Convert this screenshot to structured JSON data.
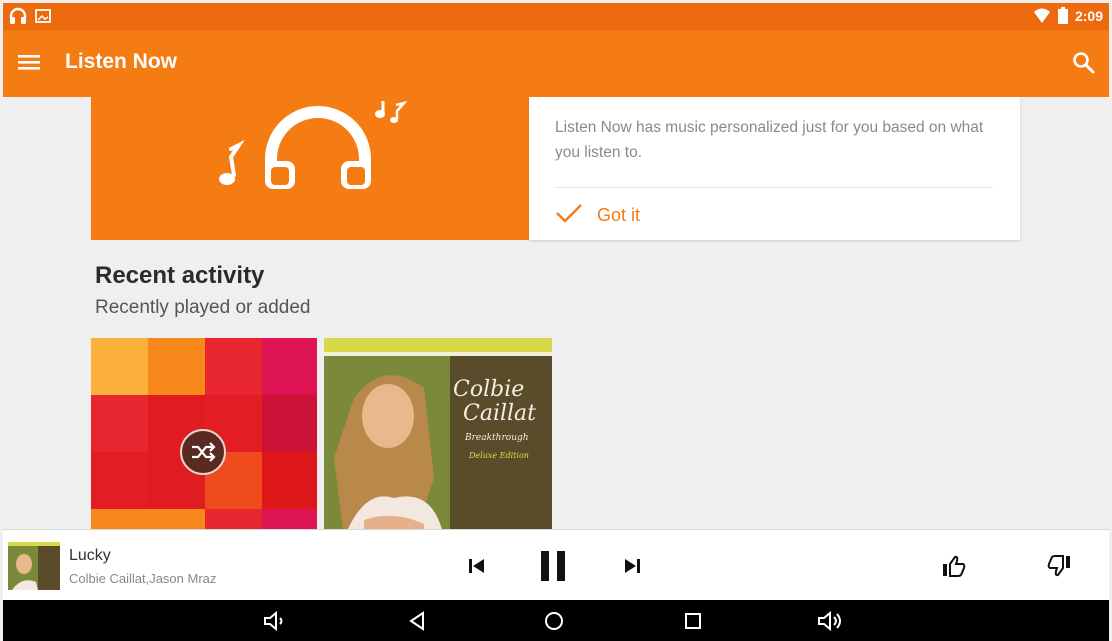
{
  "status_bar": {
    "time": "2:09",
    "left_icons": [
      "headphones-icon",
      "image-icon"
    ],
    "right_icons": [
      "wifi-icon",
      "battery-icon"
    ]
  },
  "app_bar": {
    "title": "Listen Now",
    "menu_icon": "hamburger-menu-icon",
    "search_icon": "search-icon",
    "color": "#f57c12"
  },
  "promo": {
    "text": "Listen Now has music personalized just for you based on what you listen to.",
    "action_label": "Got it",
    "action_icon": "checkmark-icon",
    "illustration_icons": [
      "headphones-icon",
      "music-note-icon",
      "music-notes-icon"
    ]
  },
  "recent": {
    "title": "Recent activity",
    "subtitle": "Recently played or added",
    "cards": [
      {
        "type": "instant-mix",
        "icon": "shuffle-icon"
      },
      {
        "type": "album",
        "art_text": [
          "Colbie",
          "Caillat",
          "Breakthrough",
          "Deluxe Edition"
        ]
      }
    ]
  },
  "now_playing": {
    "title": "Lucky",
    "artist": "Colbie Caillat,Jason Mraz",
    "controls": [
      "previous-icon",
      "pause-icon",
      "next-icon",
      "thumbs-up-icon",
      "thumbs-down-icon"
    ]
  },
  "nav_bar": {
    "buttons": [
      "volume-down-icon",
      "back-icon",
      "home-icon",
      "recents-icon",
      "volume-up-icon"
    ]
  },
  "colors": {
    "accent": "#f57c12",
    "status_bar": "#ee6a0f",
    "background": "#efefef"
  }
}
